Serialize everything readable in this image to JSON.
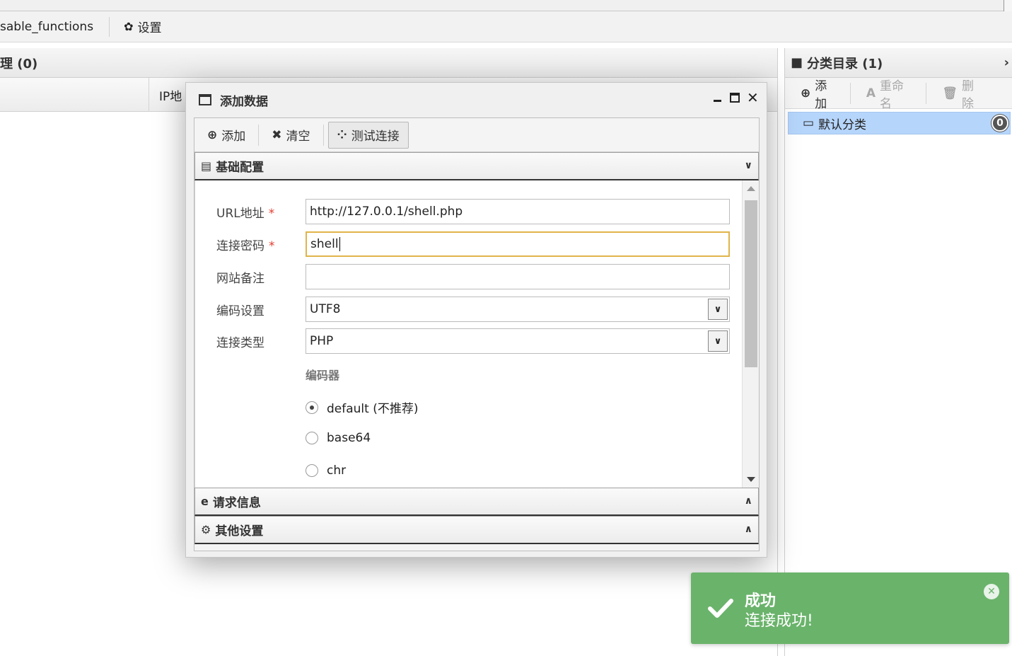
{
  "menubar": {
    "first_item": "sable_functions",
    "settings_label": "设置",
    "settings_icon": "gear-icon"
  },
  "main": {
    "panel_title": "理 (0)",
    "column_ip": "IP地"
  },
  "side": {
    "panel_title": "分类目录 (1)",
    "toolbar": {
      "add_label": "添加",
      "rename_label": "重命名",
      "delete_label": "删除"
    },
    "folder": {
      "name": "默认分类",
      "count": "0"
    }
  },
  "dialog": {
    "title": "添加数据",
    "toolbar": {
      "add_label": "添加",
      "clear_label": "清空",
      "test_label": "测试连接"
    },
    "section_basic": "基础配置",
    "section_request": "请求信息",
    "section_other": "其他设置",
    "form": {
      "url_label": "URL地址",
      "url_value": "http://127.0.0.1/shell.php",
      "password_label": "连接密码",
      "password_value": "shell",
      "note_label": "网站备注",
      "note_value": "",
      "encoding_label": "编码设置",
      "encoding_value": "UTF8",
      "type_label": "连接类型",
      "type_value": "PHP",
      "encoder_label": "编码器",
      "encoders": [
        {
          "label": "default (不推荐)",
          "selected": true
        },
        {
          "label": "base64",
          "selected": false
        },
        {
          "label": "chr",
          "selected": false
        }
      ],
      "required_mark": "*"
    }
  },
  "toast": {
    "title": "成功",
    "message": "连接成功!",
    "color": "#6ab36b"
  }
}
